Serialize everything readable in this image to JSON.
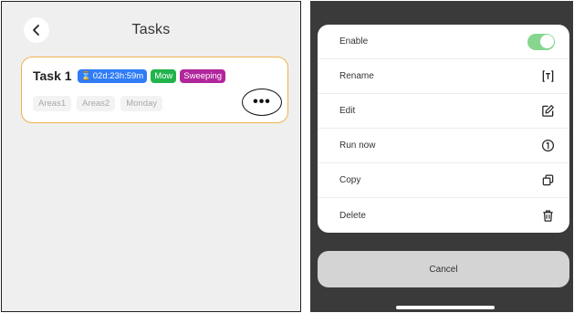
{
  "tasks_screen": {
    "title": "Tasks",
    "task": {
      "name": "Task 1",
      "countdown": "02d:23h:59m",
      "badges": [
        "Mow",
        "Sweeping"
      ],
      "areas": [
        "Areas1",
        "Areas2"
      ],
      "day": "Monday",
      "more_label": "•••"
    },
    "colors": {
      "card_border": "#f0b24a",
      "timer_badge": "#2f7cf6",
      "mow_badge": "#21b34c",
      "sweep_badge": "#b2269c"
    }
  },
  "action_sheet": {
    "items": [
      {
        "label": "Enable",
        "control": "toggle",
        "toggle_on": true
      },
      {
        "label": "Rename",
        "icon": "rename-icon"
      },
      {
        "label": "Edit",
        "icon": "edit-icon"
      },
      {
        "label": "Run now",
        "icon": "run-once-icon"
      },
      {
        "label": "Copy",
        "icon": "copy-icon"
      },
      {
        "label": "Delete",
        "icon": "trash-icon"
      }
    ],
    "cancel_label": "Cancel",
    "toggle_color": "#86d68e"
  }
}
